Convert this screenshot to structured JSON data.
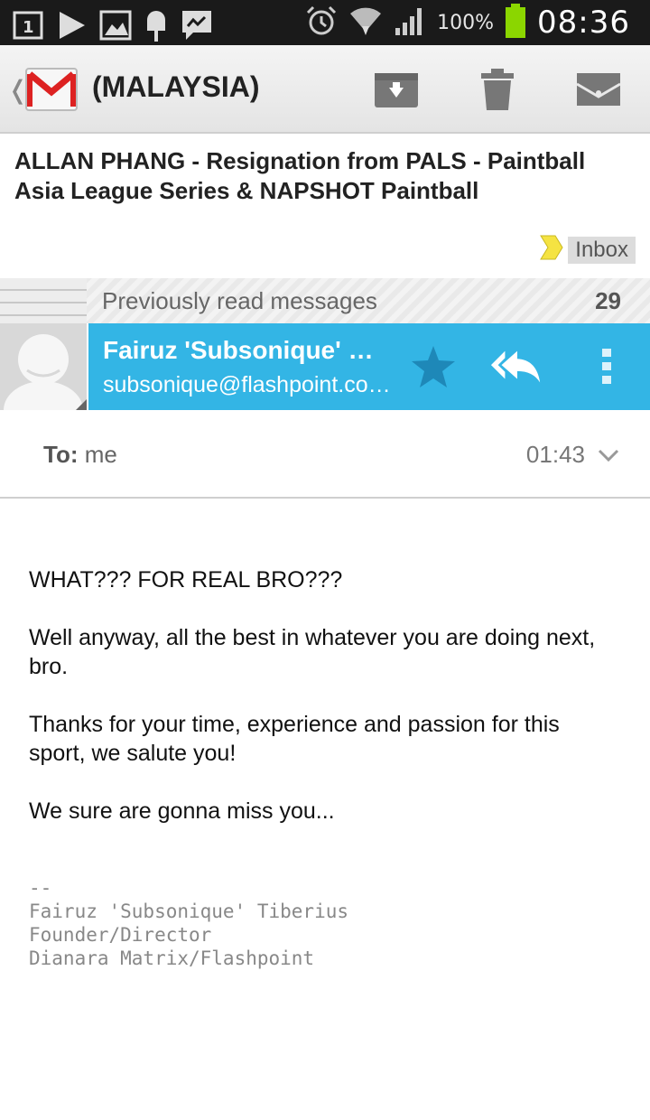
{
  "status_bar": {
    "notification_icons": [
      "sim-slot-1-icon",
      "play-store-icon",
      "gallery-icon",
      "ice-cream-icon",
      "messenger-icon"
    ],
    "system_icons": [
      "alarm-icon",
      "wifi-icon",
      "signal-icon"
    ],
    "battery_percent": "100%",
    "time": "08:36"
  },
  "action_bar": {
    "title": "(MALAYSIA)",
    "actions": [
      "archive-icon",
      "delete-icon",
      "mark-unread-icon"
    ]
  },
  "message": {
    "subject": "ALLAN PHANG - Resignation from PALS - Paintball Asia League Series & NAPSHOT Paintball",
    "label": "Inbox",
    "previously_read_label": "Previously read messages",
    "previously_read_count": "29",
    "sender_name": "Fairuz 'Subsonique' Tiberius",
    "sender_email": "subsonique@flashpoint.com.my",
    "to_label": "To:",
    "to_value": "me",
    "time": "01:43",
    "body": [
      "WHAT??? FOR REAL BRO???",
      "Well anyway, all the best in whatever you are doing next, bro.",
      "Thanks for your time, experience and passion for this sport, we salute you!",
      "We sure are gonna miss you..."
    ],
    "signature": "--\nFairuz 'Subsonique' Tiberius\nFounder/Director\nDianara Matrix/Flashpoint"
  },
  "colors": {
    "accent": "#33b5e5",
    "status_bar": "#1a1a1a",
    "battery": "#8bd600"
  }
}
